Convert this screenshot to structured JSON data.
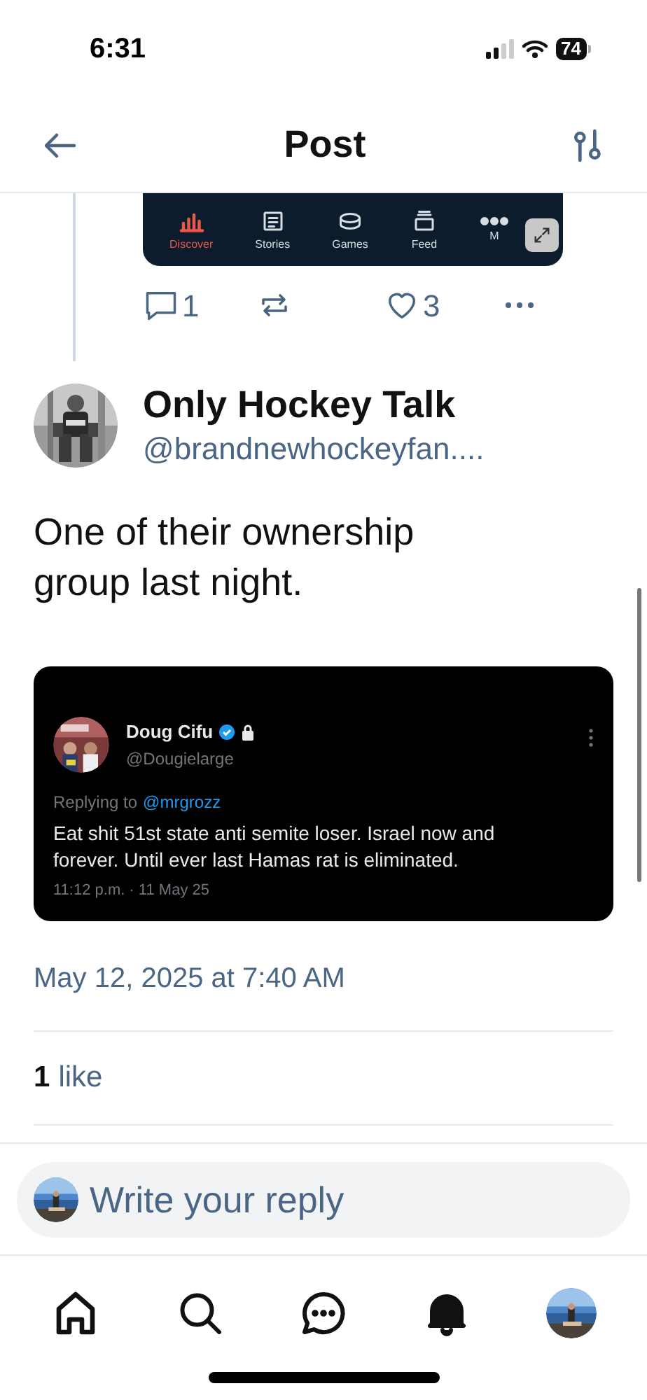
{
  "status_bar": {
    "time": "6:31",
    "battery": "74"
  },
  "header": {
    "title": "Post"
  },
  "parent_post": {
    "image_tabs": [
      {
        "kind": "chart",
        "label": "Discover",
        "selected": true
      },
      {
        "kind": "stories",
        "label": "Stories",
        "selected": false
      },
      {
        "kind": "puck",
        "label": "Games",
        "selected": false
      },
      {
        "kind": "feed",
        "label": "Feed",
        "selected": false
      },
      {
        "kind": "more",
        "label": "M",
        "selected": false
      }
    ],
    "replies": "1",
    "likes": "3"
  },
  "post": {
    "author": "Only Hockey Talk",
    "handle": "@brandnewhockeyfan....",
    "text": "One of their ownership group last night.",
    "quoted": {
      "name": "Doug Cifu",
      "handle": "@Dougielarge",
      "replying_label": "Replying to",
      "replying_to": "@mrgrozz",
      "text": "Eat shit 51st state anti semite loser.  Israel now and forever.  Until ever last Hamas rat is eliminated.",
      "timestamp": "11:12 p.m. · 11 May 25"
    },
    "date": "May 12, 2025 at 7:40 AM",
    "like_count": "1",
    "like_label": "like"
  },
  "reply": {
    "placeholder": "Write your reply"
  },
  "bottom_nav": [
    {
      "kind": "home"
    },
    {
      "kind": "search"
    },
    {
      "kind": "chat"
    },
    {
      "kind": "bell"
    },
    {
      "kind": "profile"
    }
  ]
}
